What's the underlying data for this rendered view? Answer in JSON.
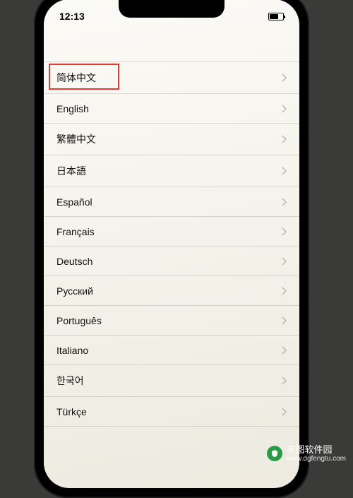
{
  "statusBar": {
    "time": "12:13"
  },
  "languages": [
    {
      "label": "简体中文",
      "highlighted": true
    },
    {
      "label": "English",
      "highlighted": false
    },
    {
      "label": "繁體中文",
      "highlighted": false
    },
    {
      "label": "日本語",
      "highlighted": false
    },
    {
      "label": "Español",
      "highlighted": false
    },
    {
      "label": "Français",
      "highlighted": false
    },
    {
      "label": "Deutsch",
      "highlighted": false
    },
    {
      "label": "Русский",
      "highlighted": false
    },
    {
      "label": "Português",
      "highlighted": false
    },
    {
      "label": "Italiano",
      "highlighted": false
    },
    {
      "label": "한국어",
      "highlighted": false
    },
    {
      "label": "Türkçe",
      "highlighted": false
    }
  ],
  "watermark": {
    "title": "丰图软件园",
    "url": "www.dgfengtu.com"
  }
}
